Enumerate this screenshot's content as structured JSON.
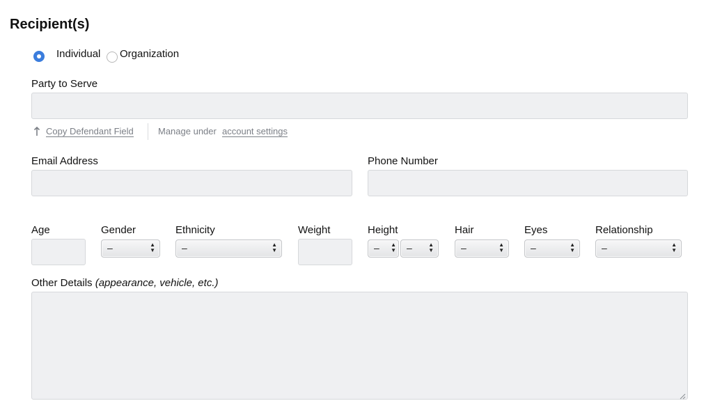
{
  "section_title": "Recipient(s)",
  "recipient_type": {
    "options": [
      "Individual",
      "Organization"
    ],
    "selected": "Individual"
  },
  "party_to_serve": {
    "label": "Party to Serve",
    "value": ""
  },
  "helpers": {
    "copy_icon": "up-arrow-icon",
    "copy_link": "Copy Defendant Field",
    "manage_prefix": "Manage under",
    "manage_link": "account settings"
  },
  "email": {
    "label": "Email Address",
    "value": ""
  },
  "phone": {
    "label": "Phone Number",
    "value": ""
  },
  "details": {
    "age": {
      "label": "Age",
      "value": ""
    },
    "gender": {
      "label": "Gender",
      "selected": "–"
    },
    "ethnicity": {
      "label": "Ethnicity",
      "selected": "–"
    },
    "weight": {
      "label": "Weight",
      "value": ""
    },
    "height": {
      "label": "Height",
      "feet": "–",
      "inches": "–"
    },
    "hair": {
      "label": "Hair",
      "selected": "–"
    },
    "eyes": {
      "label": "Eyes",
      "selected": "–"
    },
    "relationship": {
      "label": "Relationship",
      "selected": "–"
    }
  },
  "other_details": {
    "label": "Other Details",
    "hint": "(appearance, vehicle, etc.)",
    "value": ""
  },
  "colors": {
    "accent": "#3b7ddd",
    "field_bg": "#eff0f2",
    "muted_text": "#7b7f86"
  }
}
